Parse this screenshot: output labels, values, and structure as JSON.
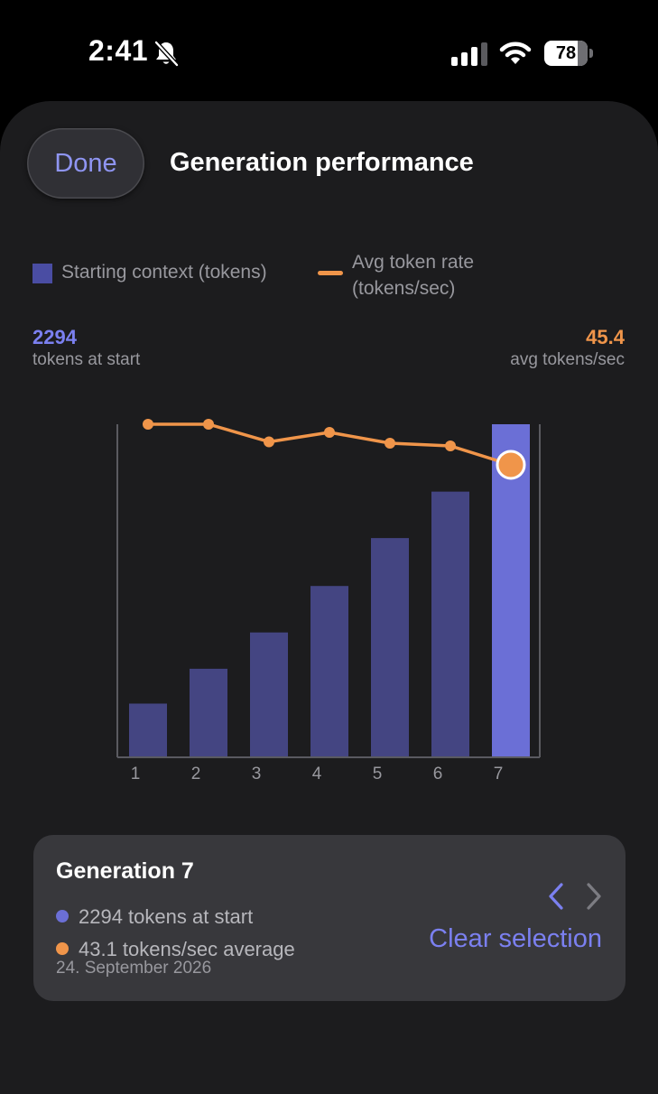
{
  "status_bar": {
    "time": "2:41",
    "battery_level": 78,
    "battery_label": "78",
    "icons": [
      "bell-slash-icon",
      "cellular-signal-icon",
      "wifi-icon",
      "battery-icon"
    ]
  },
  "header": {
    "done_label": "Done",
    "title": "Generation performance"
  },
  "legend": {
    "bar_label": "Starting context (tokens)",
    "line_label": "Avg token rate (tokens/sec)"
  },
  "stats": {
    "left_value": "2294",
    "left_caption": "tokens at start",
    "right_value": "45.4",
    "right_caption": "avg tokens/sec"
  },
  "colors": {
    "bar": "#444582",
    "bar_selected": "#6b6fd6",
    "line": "#f0954a",
    "accent": "#7b80f0",
    "axis": "#5a5a60",
    "tick_text": "#98989e"
  },
  "chart_data": {
    "type": "bar",
    "categories": [
      "1",
      "2",
      "3",
      "4",
      "5",
      "6",
      "7"
    ],
    "series": [
      {
        "name": "Starting context (tokens)",
        "type": "bar",
        "values": [
          370,
          610,
          860,
          1180,
          1510,
          1830,
          2294
        ]
      },
      {
        "name": "Avg token rate (tokens/sec)",
        "type": "line",
        "values": [
          46.1,
          46.1,
          44.8,
          45.5,
          44.7,
          44.5,
          43.1
        ]
      }
    ],
    "bar_ylim": [
      0,
      2294
    ],
    "line_ylim": [
      0,
      46.1
    ],
    "selected_index": 6,
    "grid": false,
    "legend_position": "top"
  },
  "detail": {
    "title": "Generation 7",
    "tokens_line": "2294 tokens at start",
    "rate_line": "43.1 tokens/sec average",
    "date": "24. September 2026",
    "clear_label": "Clear selection",
    "prev_icon": "chevron-left-icon",
    "next_icon": "chevron-right-icon"
  }
}
